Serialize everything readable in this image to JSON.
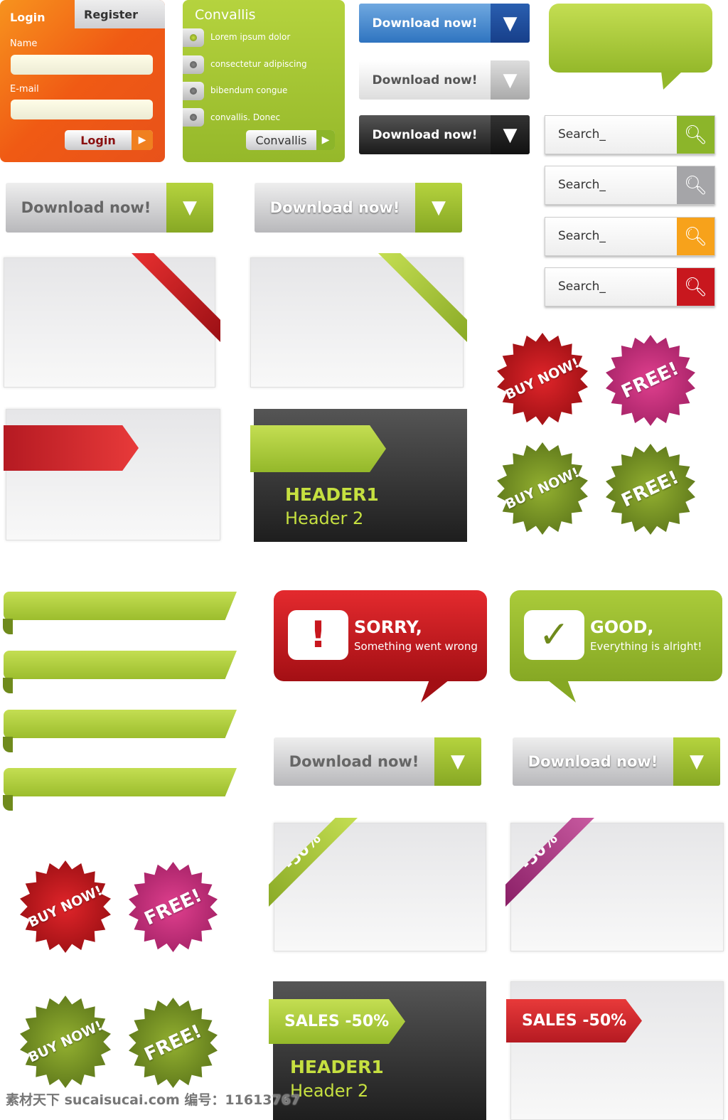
{
  "login_panel": {
    "tab_login": "Login",
    "tab_register": "Register",
    "name_label": "Name",
    "email_label": "E-mail",
    "name_value": "",
    "email_value": "",
    "button": "Login"
  },
  "convallis_panel": {
    "title": "Convallis",
    "items": [
      "Lorem   ipsum   dolor",
      "consectetur adipiscing",
      "bibendum  congue",
      "convallis.  Donec"
    ],
    "button": "Convallis"
  },
  "download_label": "Download now!",
  "search_placeholder": "Search_",
  "search_icon_colors": [
    "#8cb52a",
    "#a5a5a8",
    "#f7a21b",
    "#c8171e"
  ],
  "badges": {
    "buy": "BUY NOW!",
    "free": "FREE!"
  },
  "cards": {
    "header1": "HEADER1",
    "header2": "Header 2",
    "discount": "-50%",
    "sales": "SALES -50%"
  },
  "messages": {
    "error_title": "SORRY,",
    "error_text": "Something went wrong",
    "error_icon": "!",
    "ok_title": "GOOD,",
    "ok_text": "Everything is alright!",
    "ok_icon": "✓"
  },
  "watermark": "素材天下 sucaisucai.com  编号：11613767",
  "colors": {
    "green": "#9cbd2d",
    "red": "#c8171e",
    "orange": "#f05a14",
    "blue": "#2f74c0",
    "magenta": "#c0267a"
  }
}
